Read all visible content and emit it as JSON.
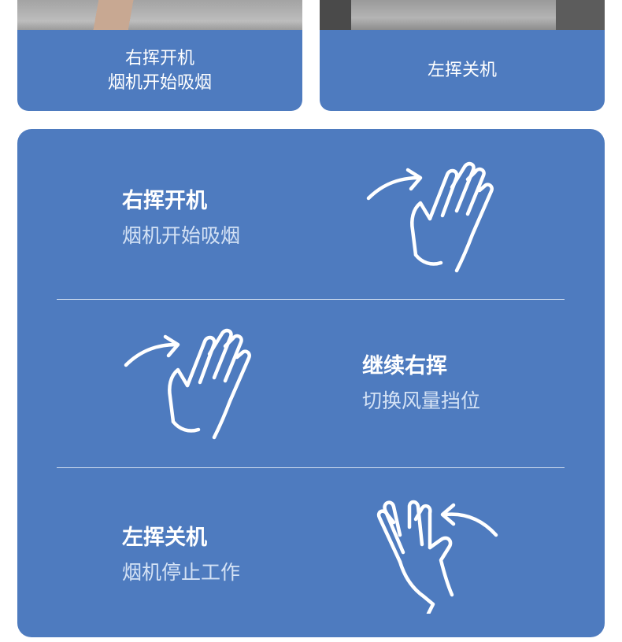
{
  "top_cards": [
    {
      "lines": [
        "右挥开机",
        "烟机开始吸烟"
      ]
    },
    {
      "lines": [
        "左挥关机"
      ]
    }
  ],
  "gestures": [
    {
      "title": "右挥开机",
      "subtitle": "烟机开始吸烟",
      "icon": "wave-right-hand-icon"
    },
    {
      "title": "继续右挥",
      "subtitle": "切换风量挡位",
      "icon": "wave-right-hand-icon"
    },
    {
      "title": "左挥关机",
      "subtitle": "烟机停止工作",
      "icon": "wave-left-hand-icon"
    }
  ],
  "colors": {
    "panel": "#4e7bbf",
    "text": "#ffffff",
    "subtext": "#d4e2f5"
  }
}
